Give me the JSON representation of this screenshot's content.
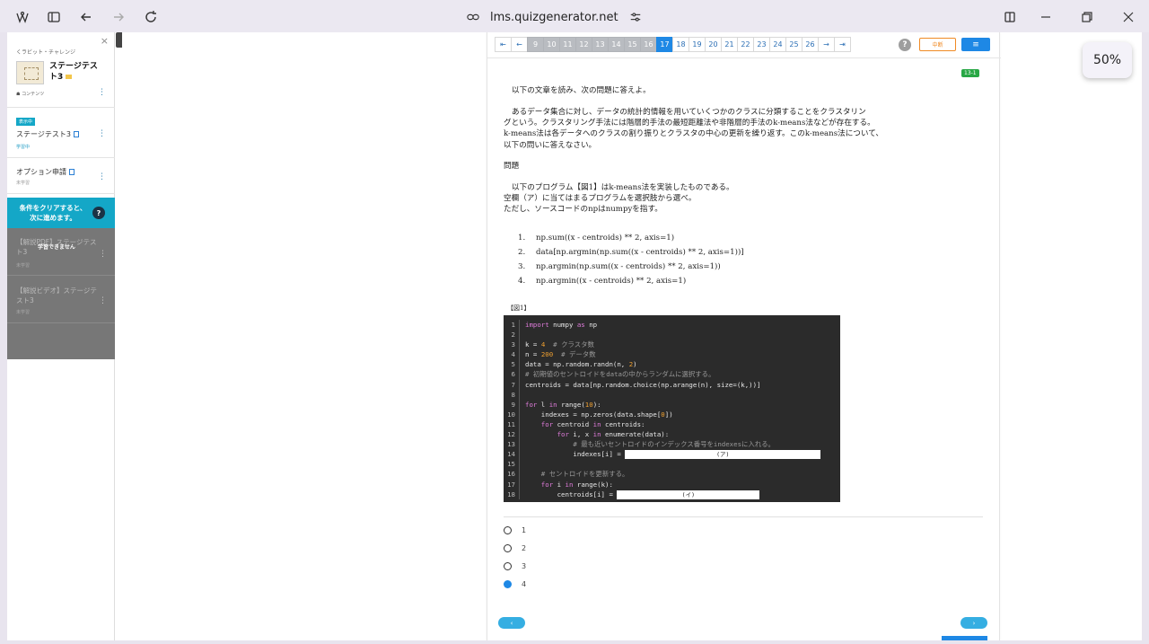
{
  "browser": {
    "url": "lms.quizgenerator.net",
    "zoom": "50%"
  },
  "sidebar": {
    "close": "×",
    "collapse": "‹",
    "breadcrumb": "くラビット・チャレンジ",
    "course_title": "ステージテスト3",
    "contents_label": "☗ コンテンツ",
    "items": [
      {
        "badge": "表示中",
        "title": "ステージテスト3",
        "status": "学習中"
      },
      {
        "title": "オプション申請",
        "status": "未学習"
      }
    ],
    "condition_banner_line1": "条件をクリアすると、",
    "condition_banner_line2": "次に進めます。",
    "condition_help": "?",
    "locked_message": "学習できません",
    "locked_items": [
      {
        "title": "【解説PDF】ステージテスト3",
        "status": "未学習"
      },
      {
        "title": "【解説ビデオ】ステージテスト3",
        "status": "未学習"
      }
    ]
  },
  "toolbar": {
    "pages": [
      "9",
      "10",
      "11",
      "12",
      "13",
      "14",
      "15",
      "16",
      "17",
      "18",
      "19",
      "20",
      "21",
      "22",
      "23",
      "24",
      "25",
      "26"
    ],
    "visited_pages": [
      "9",
      "10",
      "11",
      "12",
      "13",
      "14",
      "15",
      "16"
    ],
    "current_page": "17",
    "help": "?",
    "suspend_label": "中断",
    "menu_label": "≡"
  },
  "question": {
    "id_badge": "13-1",
    "instruction": "以下の文章を読み、次の問題に答えよ。",
    "passage": [
      "あるデータ集合に対し、データの統計的情報を用いていくつかのクラスに分類することをクラスタリン",
      "グという。クラスタリング手法には階層的手法の最短距離法や非階層的手法のk-means法などが存在する。",
      "k-means法は各データへのクラスの割り振りとクラスタの中心の更新を繰り返す。このk-means法について、",
      "以下の問いに答えなさい。"
    ],
    "heading": "問題",
    "prompt": [
      "以下のプログラム【図1】はk-means法を実装したものである。",
      "空欄（ア）に当てはまるプログラムを選択肢から選べ。",
      "ただし、ソースコードのnpはnumpyを指す。"
    ],
    "choices": [
      "np.sum((x - centroids) ** 2, axis=1)",
      "data[np.argmin(np.sum((x - centroids) ** 2, axis=1))]",
      "np.argmin(np.sum((x - centroids) ** 2, axis=1))",
      "np.argmin((x - centroids) ** 2, axis=1)"
    ],
    "figure_label": "【図1】",
    "code": {
      "l1_kw1": "import",
      "l1_mid": " numpy ",
      "l1_kw2": "as",
      "l1_end": " np",
      "l3_pre": "k = ",
      "l3_num": "4",
      "l3_cm": "  # クラスタ数",
      "l4_pre": "n = ",
      "l4_num": "200",
      "l4_cm": "  # データ数",
      "l5_pre": "data = np.random.randn(n, ",
      "l5_num": "2",
      "l5_end": ")",
      "l6_cm": "# 初期値のセントロイドをdataの中からランダムに選択する。",
      "l7": "centroids = data[np.random.choice(np.arange(n), size=(k,))]",
      "l9_kw1": "for",
      "l9_mid": " l ",
      "l9_kw2": "in",
      "l9_pre": " range(",
      "l9_num": "10",
      "l9_end": "):",
      "l10_pre": "    indexes = np.zeros(data.shape[",
      "l10_num": "0",
      "l10_end": "])",
      "l11_kw1": "    for",
      "l11_mid": " centroid ",
      "l11_kw2": "in",
      "l11_end": " centroids:",
      "l12_kw1": "        for",
      "l12_mid": " i, x ",
      "l12_kw2": "in",
      "l12_end": " enumerate(data):",
      "l13_cm": "            # 最も近いセントロイドのインデックス番号をindexesに入れる。",
      "l14_pre": "            indexes[i] = ",
      "l14_blank": "(ア)",
      "l16_cm": "    # セントロイドを更新する。",
      "l17_kw1": "    for",
      "l17_mid": " i ",
      "l17_kw2": "in",
      "l17_end": " range(k):",
      "l18_pre": "        centroids[i] = ",
      "l18_blank": "(イ)"
    }
  },
  "answers": [
    {
      "label": "1",
      "selected": false
    },
    {
      "label": "2",
      "selected": false
    },
    {
      "label": "3",
      "selected": false
    },
    {
      "label": "4",
      "selected": true
    }
  ],
  "nav": {
    "prev": "‹",
    "next": "›"
  }
}
